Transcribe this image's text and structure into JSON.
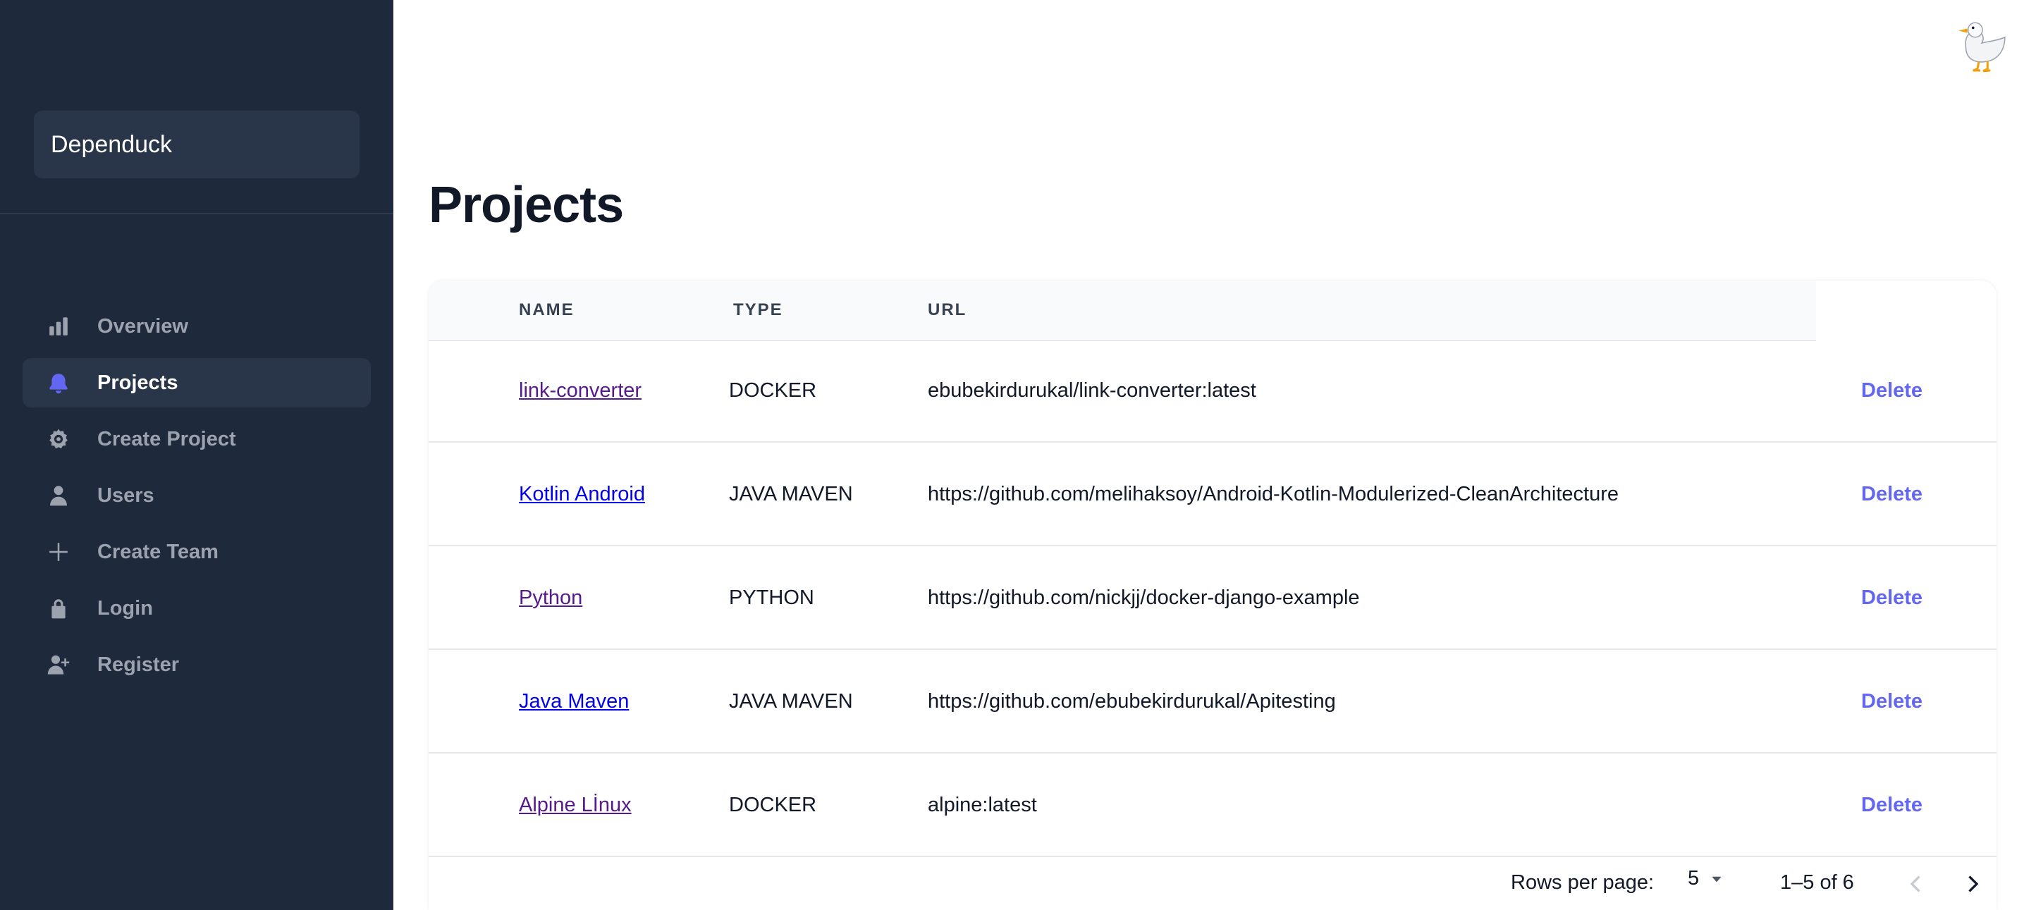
{
  "app": {
    "brand": "Dependuck"
  },
  "sidebar": {
    "items": [
      {
        "label": "Overview",
        "icon": "bar-chart-icon",
        "active": false
      },
      {
        "label": "Projects",
        "icon": "bell-icon",
        "active": true
      },
      {
        "label": "Create Project",
        "icon": "gear-icon",
        "active": false
      },
      {
        "label": "Users",
        "icon": "user-icon",
        "active": false
      },
      {
        "label": "Create Team",
        "icon": "plus-icon",
        "active": false
      },
      {
        "label": "Login",
        "icon": "lock-icon",
        "active": false
      },
      {
        "label": "Register",
        "icon": "user-plus-icon",
        "active": false
      }
    ]
  },
  "header": {
    "avatar_icon": "duck-icon"
  },
  "main": {
    "title": "Projects",
    "table": {
      "columns": [
        "NAME",
        "TYPE",
        "URL"
      ],
      "rows": [
        {
          "name": "link-converter",
          "type": "DOCKER",
          "url": "ebubekirdurukal/link-converter:latest",
          "action": "Delete"
        },
        {
          "name": "Kotlin Android",
          "type": "JAVA MAVEN",
          "url": "https://github.com/melihaksoy/Android-Kotlin-Modulerized-CleanArchitecture",
          "action": "Delete"
        },
        {
          "name": "Python",
          "type": "PYTHON",
          "url": "https://github.com/nickjj/docker-django-example",
          "action": "Delete"
        },
        {
          "name": "Java Maven",
          "type": "JAVA MAVEN",
          "url": "https://github.com/ebubekirdurukal/Apitesting",
          "action": "Delete"
        },
        {
          "name": "Alpine Lİnux",
          "type": "DOCKER",
          "url": "alpine:latest",
          "action": "Delete"
        }
      ]
    },
    "pagination": {
      "rows_per_page_label": "Rows per page:",
      "rows_per_page_value": "5",
      "range_text": "1–5 of 6"
    }
  },
  "colors": {
    "sidebar_bg": "#1e293b",
    "accent": "#6366f1",
    "link_visited": "#551a8b",
    "link_unvisited": "#0000ee"
  }
}
